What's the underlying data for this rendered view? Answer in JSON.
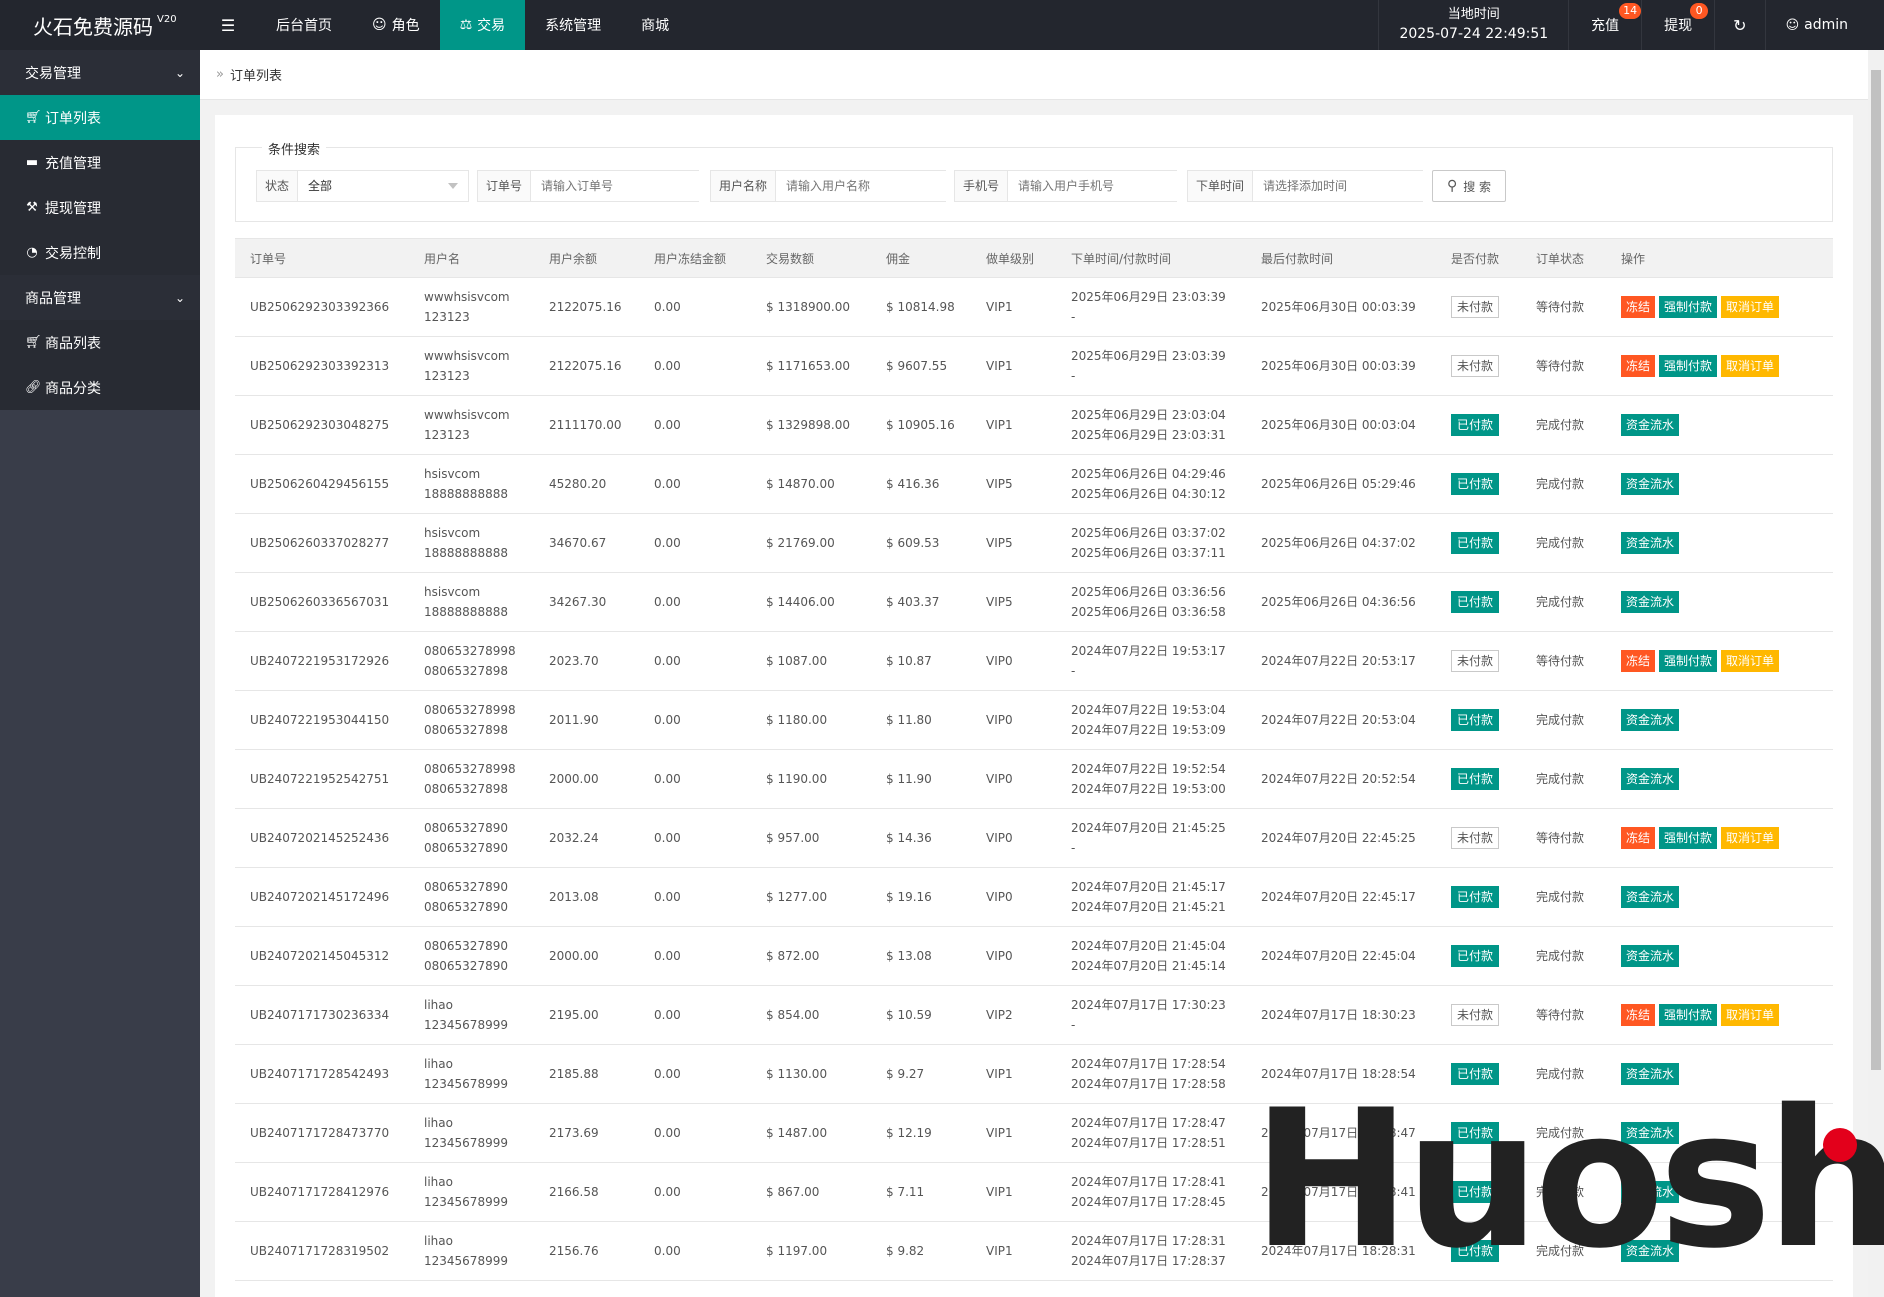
{
  "header": {
    "logo": "火石免费源码",
    "version": "V20",
    "menu_icon": "menu-icon",
    "nav": [
      {
        "label": "后台首页",
        "icon": ""
      },
      {
        "label": "角色",
        "icon": "user-icon"
      },
      {
        "label": "交易",
        "icon": "scale-icon"
      },
      {
        "label": "系统管理",
        "icon": ""
      },
      {
        "label": "商城",
        "icon": ""
      }
    ],
    "time_label": "当地时间",
    "time_value": "2025-07-24 22:49:51",
    "recharge_label": "充值",
    "recharge_badge": "14",
    "withdraw_label": "提现",
    "withdraw_badge": "0",
    "user": "admin"
  },
  "sidebar": {
    "groups": [
      {
        "label": "交易管理",
        "items": [
          {
            "label": "订单列表",
            "icon": "cart-icon"
          },
          {
            "label": "充值管理",
            "icon": "monitor-icon"
          },
          {
            "label": "提现管理",
            "icon": "hammer-icon"
          },
          {
            "label": "交易控制",
            "icon": "gauge-icon"
          }
        ]
      },
      {
        "label": "商品管理",
        "items": [
          {
            "label": "商品列表",
            "icon": "cart-icon"
          },
          {
            "label": "商品分类",
            "icon": "link-icon"
          }
        ]
      }
    ]
  },
  "breadcrumb": "订单列表",
  "search": {
    "legend": "条件搜索",
    "status_label": "状态",
    "status_value": "全部",
    "order_label": "订单号",
    "order_placeholder": "请输入订单号",
    "username_label": "用户名称",
    "username_placeholder": "请输入用户名称",
    "phone_label": "手机号",
    "phone_placeholder": "请输入用户手机号",
    "time_label": "下单时间",
    "time_placeholder": "请选择添加时间",
    "button": "搜 索"
  },
  "table": {
    "headers": [
      "订单号",
      "用户名",
      "用户余额",
      "用户冻结金额",
      "交易数额",
      "佣金",
      "做单级别",
      "下单时间/付款时间",
      "最后付款时间",
      "是否付款",
      "订单状态",
      "操作"
    ],
    "paid_label": "已付款",
    "unpaid_label": "未付款",
    "status_done": "完成付款",
    "status_wait": "等待付款",
    "btn_freeze": "冻结",
    "btn_force": "强制付款",
    "btn_cancel": "取消订单",
    "btn_flow": "资金流水",
    "rows": [
      {
        "id": "UB2506292303392366",
        "user1": "wwwhsisvcom",
        "user2": "123123",
        "balance": "2122075.16",
        "frozen": "0.00",
        "amount": "$ 1318900.00",
        "commission": "$ 10814.98",
        "level": "VIP1",
        "time1": "2025年06月29日 23:03:39",
        "time2": "-",
        "last": "2025年06月30日 00:03:39",
        "paid": false
      },
      {
        "id": "UB2506292303392313",
        "user1": "wwwhsisvcom",
        "user2": "123123",
        "balance": "2122075.16",
        "frozen": "0.00",
        "amount": "$ 1171653.00",
        "commission": "$ 9607.55",
        "level": "VIP1",
        "time1": "2025年06月29日 23:03:39",
        "time2": "-",
        "last": "2025年06月30日 00:03:39",
        "paid": false
      },
      {
        "id": "UB2506292303048275",
        "user1": "wwwhsisvcom",
        "user2": "123123",
        "balance": "2111170.00",
        "frozen": "0.00",
        "amount": "$ 1329898.00",
        "commission": "$ 10905.16",
        "level": "VIP1",
        "time1": "2025年06月29日 23:03:04",
        "time2": "2025年06月29日 23:03:31",
        "last": "2025年06月30日 00:03:04",
        "paid": true
      },
      {
        "id": "UB2506260429456155",
        "user1": "hsisvcom",
        "user2": "18888888888",
        "balance": "45280.20",
        "frozen": "0.00",
        "amount": "$ 14870.00",
        "commission": "$ 416.36",
        "level": "VIP5",
        "time1": "2025年06月26日 04:29:46",
        "time2": "2025年06月26日 04:30:12",
        "last": "2025年06月26日 05:29:46",
        "paid": true
      },
      {
        "id": "UB2506260337028277",
        "user1": "hsisvcom",
        "user2": "18888888888",
        "balance": "34670.67",
        "frozen": "0.00",
        "amount": "$ 21769.00",
        "commission": "$ 609.53",
        "level": "VIP5",
        "time1": "2025年06月26日 03:37:02",
        "time2": "2025年06月26日 03:37:11",
        "last": "2025年06月26日 04:37:02",
        "paid": true
      },
      {
        "id": "UB2506260336567031",
        "user1": "hsisvcom",
        "user2": "18888888888",
        "balance": "34267.30",
        "frozen": "0.00",
        "amount": "$ 14406.00",
        "commission": "$ 403.37",
        "level": "VIP5",
        "time1": "2025年06月26日 03:36:56",
        "time2": "2025年06月26日 03:36:58",
        "last": "2025年06月26日 04:36:56",
        "paid": true
      },
      {
        "id": "UB2407221953172926",
        "user1": "080653278998",
        "user2": "08065327898",
        "balance": "2023.70",
        "frozen": "0.00",
        "amount": "$ 1087.00",
        "commission": "$ 10.87",
        "level": "VIP0",
        "time1": "2024年07月22日 19:53:17",
        "time2": "-",
        "last": "2024年07月22日 20:53:17",
        "paid": false
      },
      {
        "id": "UB2407221953044150",
        "user1": "080653278998",
        "user2": "08065327898",
        "balance": "2011.90",
        "frozen": "0.00",
        "amount": "$ 1180.00",
        "commission": "$ 11.80",
        "level": "VIP0",
        "time1": "2024年07月22日 19:53:04",
        "time2": "2024年07月22日 19:53:09",
        "last": "2024年07月22日 20:53:04",
        "paid": true
      },
      {
        "id": "UB2407221952542751",
        "user1": "080653278998",
        "user2": "08065327898",
        "balance": "2000.00",
        "frozen": "0.00",
        "amount": "$ 1190.00",
        "commission": "$ 11.90",
        "level": "VIP0",
        "time1": "2024年07月22日 19:52:54",
        "time2": "2024年07月22日 19:53:00",
        "last": "2024年07月22日 20:52:54",
        "paid": true
      },
      {
        "id": "UB2407202145252436",
        "user1": "08065327890",
        "user2": "08065327890",
        "balance": "2032.24",
        "frozen": "0.00",
        "amount": "$ 957.00",
        "commission": "$ 14.36",
        "level": "VIP0",
        "time1": "2024年07月20日 21:45:25",
        "time2": "-",
        "last": "2024年07月20日 22:45:25",
        "paid": false
      },
      {
        "id": "UB2407202145172496",
        "user1": "08065327890",
        "user2": "08065327890",
        "balance": "2013.08",
        "frozen": "0.00",
        "amount": "$ 1277.00",
        "commission": "$ 19.16",
        "level": "VIP0",
        "time1": "2024年07月20日 21:45:17",
        "time2": "2024年07月20日 21:45:21",
        "last": "2024年07月20日 22:45:17",
        "paid": true
      },
      {
        "id": "UB2407202145045312",
        "user1": "08065327890",
        "user2": "08065327890",
        "balance": "2000.00",
        "frozen": "0.00",
        "amount": "$ 872.00",
        "commission": "$ 13.08",
        "level": "VIP0",
        "time1": "2024年07月20日 21:45:04",
        "time2": "2024年07月20日 21:45:14",
        "last": "2024年07月20日 22:45:04",
        "paid": true
      },
      {
        "id": "UB2407171730236334",
        "user1": "lihao",
        "user2": "12345678999",
        "balance": "2195.00",
        "frozen": "0.00",
        "amount": "$ 854.00",
        "commission": "$ 10.59",
        "level": "VIP2",
        "time1": "2024年07月17日 17:30:23",
        "time2": "-",
        "last": "2024年07月17日 18:30:23",
        "paid": false
      },
      {
        "id": "UB2407171728542493",
        "user1": "lihao",
        "user2": "12345678999",
        "balance": "2185.88",
        "frozen": "0.00",
        "amount": "$ 1130.00",
        "commission": "$ 9.27",
        "level": "VIP1",
        "time1": "2024年07月17日 17:28:54",
        "time2": "2024年07月17日 17:28:58",
        "last": "2024年07月17日 18:28:54",
        "paid": true
      },
      {
        "id": "UB2407171728473770",
        "user1": "lihao",
        "user2": "12345678999",
        "balance": "2173.69",
        "frozen": "0.00",
        "amount": "$ 1487.00",
        "commission": "$ 12.19",
        "level": "VIP1",
        "time1": "2024年07月17日 17:28:47",
        "time2": "2024年07月17日 17:28:51",
        "last": "2024年07月17日 18:28:47",
        "paid": true
      },
      {
        "id": "UB2407171728412976",
        "user1": "lihao",
        "user2": "12345678999",
        "balance": "2166.58",
        "frozen": "0.00",
        "amount": "$ 867.00",
        "commission": "$ 7.11",
        "level": "VIP1",
        "time1": "2024年07月17日 17:28:41",
        "time2": "2024年07月17日 17:28:45",
        "last": "2024年07月17日 18:28:41",
        "paid": true
      },
      {
        "id": "UB2407171728319502",
        "user1": "lihao",
        "user2": "12345678999",
        "balance": "2156.76",
        "frozen": "0.00",
        "amount": "$ 1197.00",
        "commission": "$ 9.82",
        "level": "VIP1",
        "time1": "2024年07月17日 17:28:31",
        "time2": "2024年07月17日 17:28:37",
        "last": "2024年07月17日 18:28:31",
        "paid": true
      }
    ]
  },
  "watermark": "Huoshi"
}
